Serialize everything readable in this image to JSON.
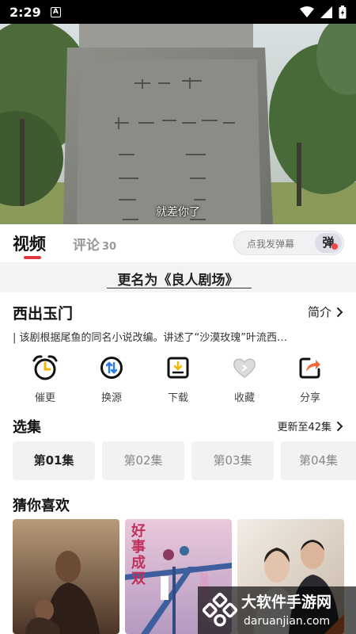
{
  "status_bar": {
    "time": "2:29",
    "badge": "A"
  },
  "video": {
    "subtitle": "就差你了"
  },
  "tabs": {
    "video": "视频",
    "comments": "评论",
    "comment_count": "30"
  },
  "danmu": {
    "placeholder": "点我发弹幕",
    "button": "弹"
  },
  "rename_banner": "更名为《良人剧场》",
  "show": {
    "title": "西出玉门",
    "intro_label": "简介",
    "description": "| 该剧根据尾鱼的同名小说改编。讲述了“沙漠玫瑰”叶流西…"
  },
  "actions": [
    {
      "label": "催更",
      "icon": "alarm-clock-icon"
    },
    {
      "label": "换源",
      "icon": "switch-source-icon"
    },
    {
      "label": "下载",
      "icon": "download-icon"
    },
    {
      "label": "收藏",
      "icon": "heart-icon"
    },
    {
      "label": "分享",
      "icon": "share-icon"
    }
  ],
  "episodes": {
    "heading": "选集",
    "update_text": "更新至42集",
    "items": [
      "第01集",
      "第02集",
      "第03集",
      "第04集"
    ]
  },
  "recommend": {
    "heading": "猜你喜欢",
    "posters": [
      {
        "name": "poster-1"
      },
      {
        "name": "poster-2",
        "title_art": "好事成双"
      },
      {
        "name": "poster-3"
      }
    ]
  },
  "watermark": {
    "cn": "大软件手游网",
    "en": "daruanjian.com"
  },
  "colors": {
    "accent": "#e0383e",
    "chip_bg": "#f2f2f3",
    "banner_bg": "#f3f3f4"
  }
}
